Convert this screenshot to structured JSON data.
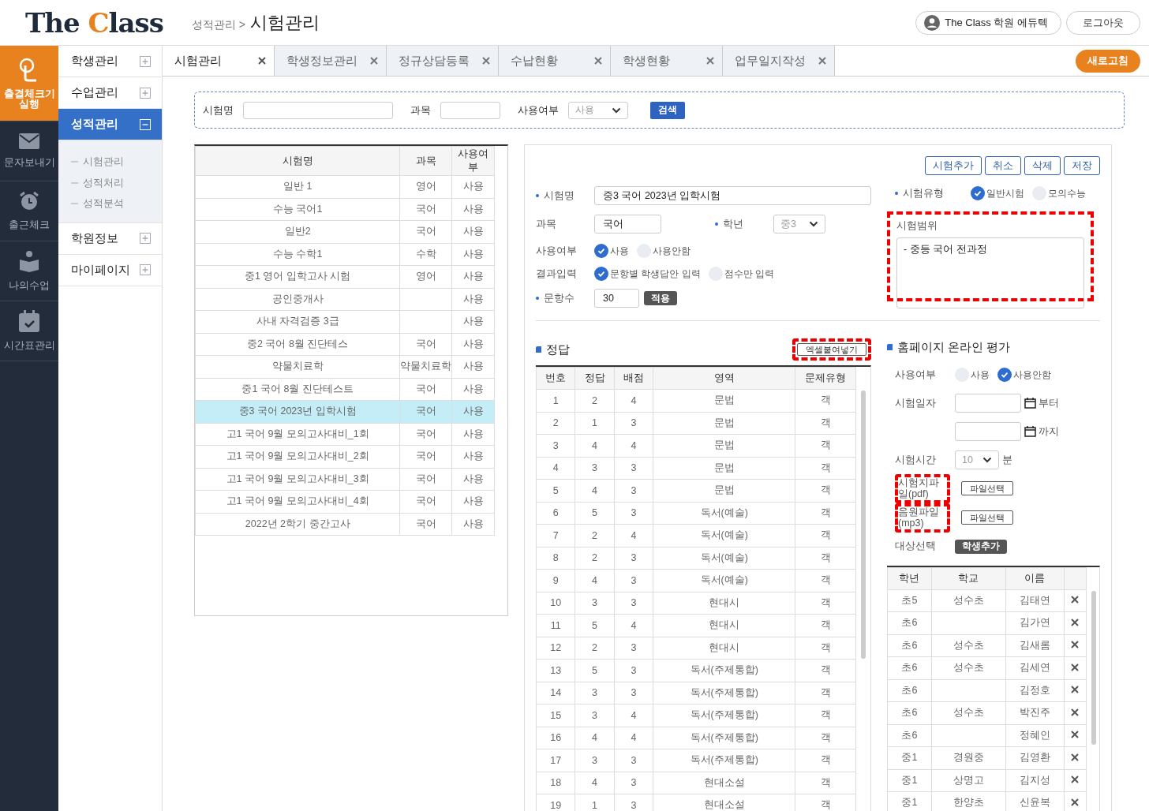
{
  "header": {
    "logo": [
      {
        "text": "The ",
        "accent": false
      },
      {
        "text": "C",
        "accent": true
      },
      {
        "text": "lass",
        "accent": false
      }
    ],
    "breadcrumb": "성적관리 >",
    "page_title": "시험관리",
    "user_button": "The Class 학원 에듀텍",
    "logout_button": "로그아웃"
  },
  "rail": [
    {
      "label": "출결체크기 실행",
      "kind": "touch",
      "selected": true
    },
    {
      "label": "문자보내기",
      "kind": "mail",
      "selected": false
    },
    {
      "label": "출근체크",
      "kind": "alarm",
      "selected": false
    },
    {
      "label": "나의수업",
      "kind": "book",
      "selected": false
    },
    {
      "label": "시간표관리",
      "kind": "calendar",
      "selected": false
    }
  ],
  "menu": [
    {
      "label": "학생관리",
      "expanded": false,
      "selected": false
    },
    {
      "label": "수업관리",
      "expanded": false,
      "selected": false
    },
    {
      "label": "성적관리",
      "expanded": true,
      "selected": true,
      "children": [
        {
          "label": "시험관리"
        },
        {
          "label": "성적처리"
        },
        {
          "label": "성적분석"
        }
      ]
    },
    {
      "label": "학원정보",
      "expanded": false,
      "selected": false
    },
    {
      "label": "마이페이지",
      "expanded": false,
      "selected": false
    }
  ],
  "tabs": [
    {
      "label": "시험관리",
      "selected": true
    },
    {
      "label": "학생정보관리",
      "selected": false
    },
    {
      "label": "정규상담등록",
      "selected": false
    },
    {
      "label": "수납현황",
      "selected": false
    },
    {
      "label": "학생현황",
      "selected": false
    },
    {
      "label": "업무일지작성",
      "selected": false
    }
  ],
  "refresh_button": "새로고침",
  "search": {
    "name_label": "시험명",
    "subject_label": "과목",
    "usage_label": "사용여부",
    "usage_value": "사용",
    "search_button": "검색"
  },
  "exam_list": {
    "columns": [
      "시험명",
      "과목",
      "사용여부"
    ],
    "rows": [
      {
        "cells": [
          "일반 1",
          "영어",
          "사용"
        ],
        "selected": false
      },
      {
        "cells": [
          "수능 국어1",
          "국어",
          "사용"
        ],
        "selected": false
      },
      {
        "cells": [
          "일반2",
          "국어",
          "사용"
        ],
        "selected": false
      },
      {
        "cells": [
          "수능 수학1",
          "수학",
          "사용"
        ],
        "selected": false
      },
      {
        "cells": [
          "중1 영어 입학고사 시험",
          "영어",
          "사용"
        ],
        "selected": false
      },
      {
        "cells": [
          "공인중개사",
          "",
          "사용"
        ],
        "selected": false
      },
      {
        "cells": [
          "사내 자격검증 3급",
          "",
          "사용"
        ],
        "selected": false
      },
      {
        "cells": [
          "중2 국어 8월 진단테스",
          "국어",
          "사용"
        ],
        "selected": false
      },
      {
        "cells": [
          "약물치료학",
          "약물치료학",
          "사용"
        ],
        "selected": false
      },
      {
        "cells": [
          "중1 국어 8월 진단테스트",
          "국어",
          "사용"
        ],
        "selected": false
      },
      {
        "cells": [
          "중3 국어 2023년 입학시험",
          "국어",
          "사용"
        ],
        "selected": true
      },
      {
        "cells": [
          "고1 국어 9월 모의고사대비_1회",
          "국어",
          "사용"
        ],
        "selected": false
      },
      {
        "cells": [
          "고1 국어 9월 모의고사대비_2회",
          "국어",
          "사용"
        ],
        "selected": false
      },
      {
        "cells": [
          "고1 국어 9월 모의고사대비_3회",
          "국어",
          "사용"
        ],
        "selected": false
      },
      {
        "cells": [
          "고1 국어 9월 모의고사대비_4회",
          "국어",
          "사용"
        ],
        "selected": false
      },
      {
        "cells": [
          "2022년 2학기 중간고사",
          "국어",
          "사용"
        ],
        "selected": false
      }
    ]
  },
  "editor": {
    "buttons": [
      "시험추가",
      "취소",
      "삭제",
      "저장"
    ],
    "name": {
      "label": "시험명",
      "required": true,
      "value": "중3 국어 2023년 입학시험"
    },
    "subject": {
      "label": "과목",
      "value": "국어"
    },
    "grade": {
      "label": "학년",
      "required": true,
      "value": "중3"
    },
    "usage": {
      "label": "사용여부",
      "options": [
        {
          "label": "사용",
          "selected": true
        },
        {
          "label": "사용안함",
          "selected": false
        }
      ]
    },
    "result_input": {
      "label": "결과입력",
      "options": [
        {
          "label": "문항별 학생답안 입력",
          "selected": true
        },
        {
          "label": "점수만 입력",
          "selected": false
        }
      ]
    },
    "question_count": {
      "label": "문항수",
      "required": true,
      "value": "30",
      "button": "적용"
    },
    "exam_type": {
      "label": "시험유형",
      "required": true,
      "options": [
        {
          "label": "일반시험",
          "selected": true
        },
        {
          "label": "모의수능",
          "selected": false
        }
      ]
    },
    "scope": {
      "label": "시험범위",
      "value": "-  중등 국어 전과정",
      "highlighted": true
    }
  },
  "answers": {
    "title": "정답",
    "paste_button": {
      "label": "엑셀붙여넣기",
      "highlighted": true
    },
    "columns": [
      "번호",
      "정답",
      "배점",
      "영역",
      "문제유형"
    ],
    "rows": [
      [
        "1",
        "2",
        "4",
        "문법",
        "객"
      ],
      [
        "2",
        "1",
        "3",
        "문법",
        "객"
      ],
      [
        "3",
        "4",
        "4",
        "문법",
        "객"
      ],
      [
        "4",
        "3",
        "3",
        "문법",
        "객"
      ],
      [
        "5",
        "4",
        "3",
        "문법",
        "객"
      ],
      [
        "6",
        "5",
        "3",
        "독서(예술)",
        "객"
      ],
      [
        "7",
        "2",
        "4",
        "독서(예술)",
        "객"
      ],
      [
        "8",
        "2",
        "3",
        "독서(예술)",
        "객"
      ],
      [
        "9",
        "4",
        "3",
        "독서(예술)",
        "객"
      ],
      [
        "10",
        "3",
        "3",
        "현대시",
        "객"
      ],
      [
        "11",
        "5",
        "4",
        "현대시",
        "객"
      ],
      [
        "12",
        "2",
        "3",
        "현대시",
        "객"
      ],
      [
        "13",
        "5",
        "3",
        "독서(주제통합)",
        "객"
      ],
      [
        "14",
        "3",
        "3",
        "독서(주제통합)",
        "객"
      ],
      [
        "15",
        "3",
        "4",
        "독서(주제통합)",
        "객"
      ],
      [
        "16",
        "4",
        "4",
        "독서(주제통합)",
        "객"
      ],
      [
        "17",
        "3",
        "3",
        "독서(주제통합)",
        "객"
      ],
      [
        "18",
        "4",
        "3",
        "현대소설",
        "객"
      ],
      [
        "19",
        "1",
        "3",
        "현대소설",
        "객"
      ]
    ]
  },
  "online": {
    "title": "홈페이지 온라인 평가",
    "usage": {
      "label": "사용여부",
      "options": [
        {
          "label": "사용",
          "selected": false
        },
        {
          "label": "사용안함",
          "selected": true
        }
      ]
    },
    "date": {
      "label": "시험일자",
      "from_suffix": "부터",
      "to_suffix": "까지"
    },
    "duration": {
      "label": "시험시간",
      "value": "10",
      "unit": "분"
    },
    "files": [
      {
        "label": "시험지파일(pdf)",
        "button": "파일선택",
        "highlighted": true
      },
      {
        "label": "음원파일(mp3)",
        "button": "파일선택",
        "highlighted": true
      }
    ],
    "target": {
      "label": "대상선택",
      "button": "학생추가"
    },
    "students": {
      "columns": [
        "학년",
        "학교",
        "이름"
      ],
      "rows": [
        [
          "초5",
          "성수초",
          "김태연"
        ],
        [
          "초6",
          "",
          "김가연"
        ],
        [
          "초6",
          "성수초",
          "김새롬"
        ],
        [
          "초6",
          "성수초",
          "김세연"
        ],
        [
          "초6",
          "",
          "김정호"
        ],
        [
          "초6",
          "성수초",
          "박진주"
        ],
        [
          "초6",
          "",
          "정혜인"
        ],
        [
          "중1",
          "경원중",
          "김영환"
        ],
        [
          "중1",
          "상명고",
          "김지성"
        ],
        [
          "중1",
          "한양초",
          "신윤복"
        ]
      ]
    }
  }
}
